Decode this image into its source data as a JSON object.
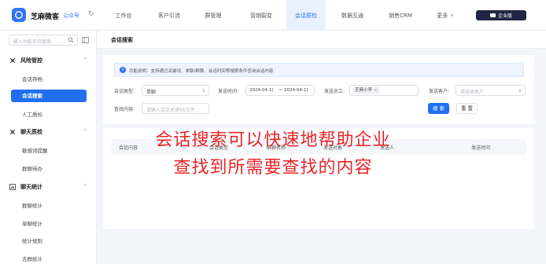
{
  "header": {
    "brand": "芝麻微客",
    "account": "公众号",
    "nav": [
      {
        "label": "工作台"
      },
      {
        "label": "客户引流"
      },
      {
        "label": "群管理"
      },
      {
        "label": "营销裂变"
      },
      {
        "label": "会话质检"
      },
      {
        "label": "数据互通"
      },
      {
        "label": "销售CRM"
      },
      {
        "label": "更多"
      }
    ],
    "enterprise_label": "企业版"
  },
  "sidebar": {
    "search_placeholder": "输入功能名称搜索",
    "groups": [
      {
        "label": "风险管控",
        "items": [
          "会话存档",
          "会话搜索",
          "人工质检"
        ]
      },
      {
        "label": "聊天质检",
        "items": [
          "敏感词提醒",
          "群聊待办"
        ]
      },
      {
        "label": "聊天统计",
        "items": [
          "群聊统计",
          "单聊统计",
          "统计规则",
          "去群统计"
        ]
      }
    ]
  },
  "page": {
    "title": "会话搜索"
  },
  "filters": {
    "notice": "功能说明：支持通过关键词、单聊/群聊、会话时间等搜索条件查询会话内容",
    "session_type_label": "会话类型:",
    "session_type_value": "单聊",
    "send_time_label": "发送时间:",
    "date_start": "2024-04-1(",
    "date_sep": "~",
    "date_end": "2024-04-1(",
    "staff_label": "发送员工:",
    "staff_tag": "芝麻小李",
    "customer_label": "发送客户:",
    "customer_placeholder": "请选择客户",
    "keyword_label": "查找内容:",
    "keyword_placeholder": "请输入会话关键词/文件...",
    "search_button": "搜 索",
    "reset_button": "重 置"
  },
  "table": {
    "columns": [
      "会话内容",
      "会话类型",
      "群聊名称",
      "发送对象",
      "发送人",
      "发送时间"
    ]
  },
  "overlay": {
    "line1": "会话搜索可以快速地帮助企业",
    "line2": "查找到所需要查找的内容"
  },
  "colors": {
    "accent": "#1f6ff0",
    "overlay_text": "#e8262a"
  }
}
